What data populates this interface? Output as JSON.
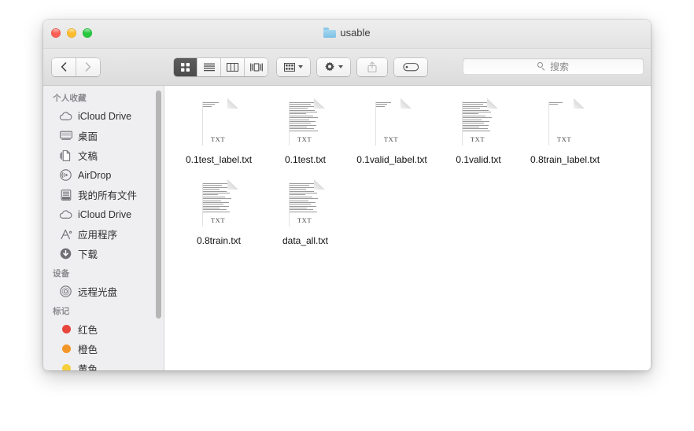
{
  "window": {
    "title": "usable",
    "folder_icon": "folder-icon",
    "traffic_lights": [
      {
        "name": "close-button",
        "color": "#ff5f57"
      },
      {
        "name": "minimize-button",
        "color": "#ffbd2e"
      },
      {
        "name": "maximize-button",
        "color": "#28c840"
      }
    ]
  },
  "toolbar": {
    "back_label": "‹",
    "forward_label": "›",
    "view_buttons": [
      {
        "name": "icon-view-button",
        "icon": "grid-icon",
        "selected": true
      },
      {
        "name": "list-view-button",
        "icon": "list-icon",
        "selected": false
      },
      {
        "name": "column-view-button",
        "icon": "columns-icon",
        "selected": false
      },
      {
        "name": "coverflow-view-button",
        "icon": "coverflow-icon",
        "selected": false
      }
    ],
    "arrange_button": {
      "name": "arrange-button",
      "icon": "arrange-grid-icon"
    },
    "action_button": {
      "name": "action-button",
      "icon": "gear-icon"
    },
    "share_button": {
      "name": "share-button",
      "icon": "share-icon",
      "disabled": true
    },
    "tag_button": {
      "name": "tag-button",
      "icon": "tag-icon"
    }
  },
  "search": {
    "placeholder": "搜索",
    "value": "",
    "icon": "search-icon"
  },
  "sidebar": {
    "sections": [
      {
        "header": "个人收藏",
        "items": [
          {
            "label": "iCloud Drive",
            "icon": "cloud-icon"
          },
          {
            "label": "桌面",
            "icon": "desktop-icon"
          },
          {
            "label": "文稿",
            "icon": "documents-icon"
          },
          {
            "label": "AirDrop",
            "icon": "airdrop-icon"
          },
          {
            "label": "我的所有文件",
            "icon": "all-files-icon"
          },
          {
            "label": "iCloud Drive",
            "icon": "cloud-icon"
          },
          {
            "label": "应用程序",
            "icon": "applications-icon"
          },
          {
            "label": "下载",
            "icon": "downloads-icon"
          }
        ]
      },
      {
        "header": "设备",
        "items": [
          {
            "label": "远程光盘",
            "icon": "remote-disc-icon"
          }
        ]
      },
      {
        "header": "标记",
        "items": [
          {
            "label": "红色",
            "icon": "tag-dot-icon",
            "color": "#e8453c"
          },
          {
            "label": "橙色",
            "icon": "tag-dot-icon",
            "color": "#f3962a"
          },
          {
            "label": "黄色",
            "icon": "tag-dot-icon",
            "color": "#f6cf3d"
          }
        ]
      }
    ]
  },
  "files": [
    {
      "name": "0.1test_label.txt",
      "type": "TXT",
      "preview_lines": 3
    },
    {
      "name": "0.1test.txt",
      "type": "TXT",
      "preview_lines": 22
    },
    {
      "name": "0.1valid_label.txt",
      "type": "TXT",
      "preview_lines": 3
    },
    {
      "name": "0.1valid.txt",
      "type": "TXT",
      "preview_lines": 22
    },
    {
      "name": "0.8train_label.txt",
      "type": "TXT",
      "preview_lines": 2
    },
    {
      "name": "0.8train.txt",
      "type": "TXT",
      "preview_lines": 16
    },
    {
      "name": "data_all.txt",
      "type": "TXT",
      "preview_lines": 16
    }
  ]
}
